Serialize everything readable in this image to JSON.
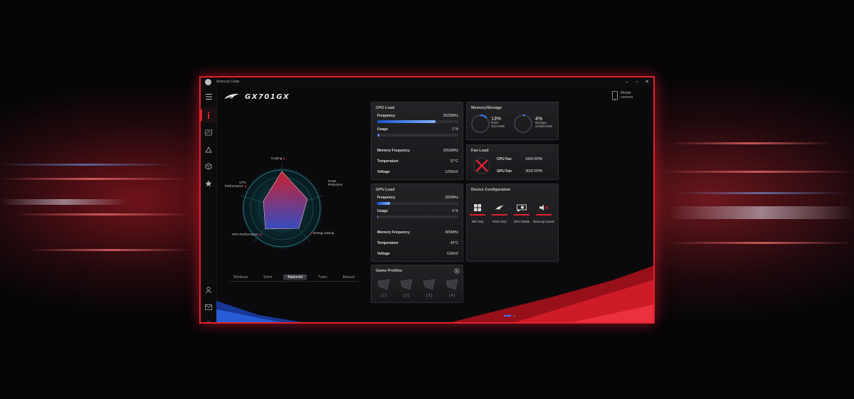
{
  "app": {
    "title": "Armoury Crate",
    "model": "GX701GX",
    "mobile_connect": [
      "Mobile",
      "connect"
    ]
  },
  "window_controls": {
    "minimize": "–",
    "maximize": "▫",
    "close": "✕"
  },
  "sidebar": {
    "items": [
      {
        "icon": "menu-icon"
      },
      {
        "icon": "info-icon",
        "active": true
      },
      {
        "icon": "display-icon"
      },
      {
        "icon": "aura-triangle-icon"
      },
      {
        "icon": "cube-icon"
      },
      {
        "icon": "star-icon"
      }
    ],
    "bottom_items": [
      {
        "icon": "user-icon"
      },
      {
        "icon": "mail-icon"
      },
      {
        "icon": "settings-icon"
      }
    ]
  },
  "radar": {
    "labels": {
      "cooling": "Cooling",
      "noise_reduction": [
        "Noise",
        "Reduction"
      ],
      "energy_saving": "Energy Saving",
      "gpu_performance": "GPU Performance",
      "cpu_performance": [
        "CPU",
        "Performance"
      ]
    }
  },
  "modes": {
    "items": [
      "Windows",
      "Silent",
      "Balanced",
      "Turbo",
      "Manual"
    ],
    "active": "Balanced"
  },
  "cpu_load": {
    "title": "CPU Load",
    "frequency_label": "Frequency",
    "frequency_value": "3920MHz",
    "frequency_fill": 0.72,
    "usage_label": "Usage",
    "usage_value": "2 %",
    "usage_fill": 0.02,
    "memory_frequency_label": "Memory Frequency",
    "memory_frequency_value": "2653MHz",
    "temperature_label": "Temperature",
    "temperature_value": "57°C",
    "voltage_label": "Voltage",
    "voltage_value": "1205mV"
  },
  "gpu_load": {
    "title": "GPU Load",
    "frequency_label": "Frequency",
    "frequency_value": "300MHz",
    "frequency_fill": 0.16,
    "usage_label": "Usage",
    "usage_value": "0 %",
    "usage_fill": 0.0,
    "memory_frequency_label": "Memory Frequency",
    "memory_frequency_value": "405MHz",
    "temperature_label": "Temperature",
    "temperature_value": "42°C",
    "voltage_label": "Voltage",
    "voltage_value": "618mV"
  },
  "memory_storage": {
    "title": "Memory/Storage",
    "ram_percent": "13%",
    "ram_label": "RAM",
    "ram_detail": "3/23.9GB",
    "ram_fill": 0.13,
    "storage_percent": "4%",
    "storage_label": "Storage",
    "storage_detail": "41/952.0GB",
    "storage_fill": 0.04
  },
  "fan_load": {
    "title": "Fan Load",
    "cpu_fan_label": "CPU Fan",
    "cpu_fan_value": "3400 RPM",
    "gpu_fan_label": "GPU Fan",
    "gpu_fan_value": "3000 RPM"
  },
  "device_config": {
    "title": "Device Configuration",
    "items": [
      {
        "label": "Win Key",
        "icon": "windows-key-icon"
      },
      {
        "label": "ROG Key",
        "icon": "rog-key-icon"
      },
      {
        "label": "GPU Mode",
        "icon": "gpu-mode-icon"
      },
      {
        "label": "Boot up sound",
        "icon": "boot-sound-icon"
      }
    ]
  },
  "game_profiles": {
    "title": "Game Profiles",
    "slots": [
      "[ 1 ]",
      "[ 2 ]",
      "[ 3 ]",
      "[ 4 ]"
    ]
  },
  "colors": {
    "accent": "#e0202e",
    "bar_blue": "#3a7bff",
    "panel": "#1d1d20"
  }
}
